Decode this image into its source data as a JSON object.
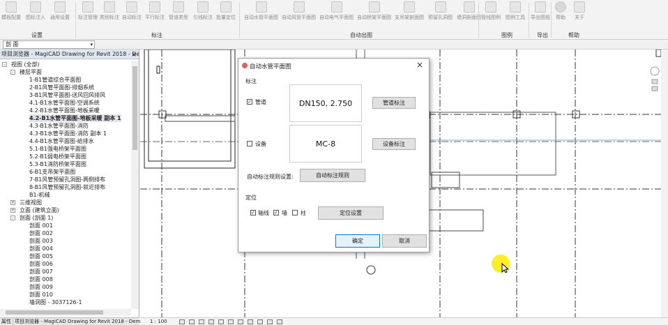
{
  "ribbon": {
    "buttons": [
      {
        "label": "模板配置",
        "icon": "template-config-icon"
      },
      {
        "label": "图标注入",
        "icon": "symbol-inject-icon"
      },
      {
        "label": "通用设置",
        "icon": "general-settings-icon"
      },
      {
        "label": "标注管理",
        "icon": "annotation-manage-icon"
      },
      {
        "label": "类别标注",
        "icon": "category-tag-icon"
      },
      {
        "label": "自动标注",
        "icon": "auto-tag-icon"
      },
      {
        "label": "平行标注",
        "icon": "parallel-tag-icon"
      },
      {
        "label": "管道类型",
        "icon": "pipe-type-icon"
      },
      {
        "label": "引线标注",
        "icon": "leader-tag-icon"
      },
      {
        "label": "批量定位",
        "icon": "batch-locate-icon"
      },
      {
        "label": "自动水管平面图",
        "icon": "auto-water-plan-icon"
      },
      {
        "label": "自动风管平面图",
        "icon": "auto-duct-plan-icon"
      },
      {
        "label": "自动电气平面图",
        "icon": "auto-electric-plan-icon"
      },
      {
        "label": "自动桥架平面图",
        "icon": "auto-tray-plan-icon"
      },
      {
        "label": "支吊架剖面图",
        "icon": "hanger-section-icon"
      },
      {
        "label": "预留孔洞图",
        "icon": "reserved-hole-icon"
      },
      {
        "label": "墙洞剖面图",
        "icon": "wall-hole-section-icon"
      },
      {
        "label": "管线图例",
        "icon": "pipe-legend-icon"
      },
      {
        "label": "图例工具",
        "icon": "legend-tool-icon"
      },
      {
        "label": "导出图纸",
        "icon": "export-drawing-icon"
      },
      {
        "label": "帮助",
        "icon": "help-icon"
      },
      {
        "label": "关于",
        "icon": "about-icon"
      }
    ],
    "groups": [
      "设置",
      "标注",
      "自动出图",
      "图例",
      "导出",
      "帮助"
    ]
  },
  "properties": {
    "selector_value": "剖  面"
  },
  "browser": {
    "title": "项目浏览器 - MagiCAD Drawing for Revit 2018 - Demo Pro...",
    "close": "×",
    "tree": [
      {
        "label": "视图 (全部)",
        "indent": 0,
        "toggle": "-"
      },
      {
        "label": "楼层平面",
        "indent": 1,
        "toggle": "-"
      },
      {
        "label": "1-B1管道综合平面图",
        "indent": 2
      },
      {
        "label": "2-B1风管平面图-排烟系统",
        "indent": 2
      },
      {
        "label": "3-B1风管平面图-送风回风排风",
        "indent": 2
      },
      {
        "label": "4.1-B1水管平面图-空调系统",
        "indent": 2
      },
      {
        "label": "4.2-B1水管平面图-地板采暖",
        "indent": 2
      },
      {
        "label": "4.2-B1水管平面图-地板采暖 副本 1",
        "indent": 2,
        "selected": true
      },
      {
        "label": "4.3-B1水管平面图-消防",
        "indent": 2
      },
      {
        "label": "4.3-B1水管平面图-消防 副本 1",
        "indent": 2
      },
      {
        "label": "4.4-B1水管平面图-给排水",
        "indent": 2
      },
      {
        "label": "5.1-B1强电桥架平面图",
        "indent": 2
      },
      {
        "label": "5.2-B1弱电桥架平面图",
        "indent": 2
      },
      {
        "label": "5.3-B1消防桥架平面图",
        "indent": 2
      },
      {
        "label": "6-B1支吊架平面图",
        "indent": 2
      },
      {
        "label": "7-B1风管预留孔洞图-两侧排布",
        "indent": 2
      },
      {
        "label": "8-B1风管预留孔洞图-就近排布",
        "indent": 2
      },
      {
        "label": "B1-机械",
        "indent": 2
      },
      {
        "label": "三维视图",
        "indent": 1,
        "toggle": "+"
      },
      {
        "label": "立面 (建筑立面)",
        "indent": 1,
        "toggle": "+"
      },
      {
        "label": "剖面 (剖面 1)",
        "indent": 1,
        "toggle": "-"
      },
      {
        "label": "剖面 001",
        "indent": 2
      },
      {
        "label": "剖面 002",
        "indent": 2
      },
      {
        "label": "剖面 003",
        "indent": 2
      },
      {
        "label": "剖面 004",
        "indent": 2
      },
      {
        "label": "剖面 005",
        "indent": 2
      },
      {
        "label": "剖面 006",
        "indent": 2
      },
      {
        "label": "剖面 007",
        "indent": 2
      },
      {
        "label": "剖面 008",
        "indent": 2
      },
      {
        "label": "剖面 009",
        "indent": 2
      },
      {
        "label": "剖面 010",
        "indent": 2
      },
      {
        "label": "墙洞图 - 3037126-1",
        "indent": 2
      }
    ],
    "bottom_tabs": [
      "属性",
      "项目浏览器 - MagiCAD Drawing for Revit 2018 - Dem..."
    ]
  },
  "status": {
    "scale": "1 : 100"
  },
  "dialog": {
    "title": "自动水管平面图",
    "close": "×",
    "section_annotation": "标注",
    "pipe_checkbox_label": "管道",
    "pipe_checked": true,
    "pipe_preview": "DN150, 2.750",
    "pipe_button": "管道标注",
    "equipment_checkbox_label": "设备",
    "equipment_checked": false,
    "equipment_preview": "MC-8",
    "equipment_button": "设备标注",
    "rule_label": "自动标注规则设置:",
    "rule_button": "自动标注规则",
    "section_position": "定位",
    "axis_label": "轴线",
    "axis_checked": true,
    "wall_label": "墙",
    "wall_checked": true,
    "column_label": "柱",
    "column_checked": false,
    "position_button": "定位设置",
    "ok_button": "确定",
    "cancel_button": "取消"
  }
}
